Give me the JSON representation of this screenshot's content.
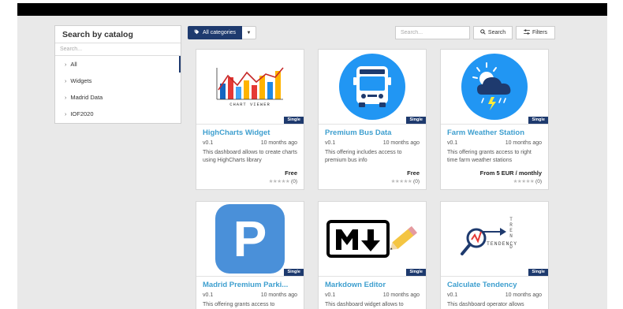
{
  "sidebar": {
    "title": "Search by catalog",
    "search_placeholder": "Search...",
    "items": [
      {
        "label": "All"
      },
      {
        "label": "Widgets"
      },
      {
        "label": "Madrid Data"
      },
      {
        "label": "IOF2020"
      }
    ]
  },
  "toolbar": {
    "category_label": "All categories",
    "search_placeholder": "Search...",
    "search_label": "Search",
    "filters_label": "Filters"
  },
  "cards": [
    {
      "title": "HighCharts Widget",
      "version": "v0.1",
      "time": "10 months ago",
      "desc": "This dashboard allows to create charts using HighCharts library",
      "price": "Free",
      "rating": "(0)",
      "badge": "Single",
      "image_icon": "chart-viewer-icon",
      "caption": "CHART VIEWER"
    },
    {
      "title": "Premium Bus Data",
      "version": "v0.1",
      "time": "10 months ago",
      "desc": "This offering includes access to premium bus info",
      "price": "Free",
      "rating": "(0)",
      "badge": "Single",
      "image_icon": "bus-icon"
    },
    {
      "title": "Farm Weather Station",
      "version": "v0.1",
      "time": "10 months ago",
      "desc": "This offering grants access to right time farm weather stations",
      "price": "From 5 EUR / monthly",
      "rating": "(0)",
      "badge": "Single",
      "image_icon": "weather-icon"
    },
    {
      "title": "Madrid Premium Parki...",
      "version": "v0.1",
      "time": "10 months ago",
      "desc": "This offering grants access to",
      "badge": "Single",
      "image_icon": "parking-icon",
      "letter": "P"
    },
    {
      "title": "Markdown Editor",
      "version": "v0.1",
      "time": "10 months ago",
      "desc": "This dashboard widget allows to",
      "badge": "Single",
      "image_icon": "markdown-icon"
    },
    {
      "title": "Calculate Tendency",
      "version": "v0.1",
      "time": "10 months ago",
      "desc": "This dashboard operator allows",
      "badge": "Single",
      "image_icon": "tendency-icon",
      "caption": "TENDENCY"
    }
  ],
  "colors": {
    "accent": "#1e3a6e",
    "title": "#3e9fcf",
    "background": "#e9e9e9"
  }
}
